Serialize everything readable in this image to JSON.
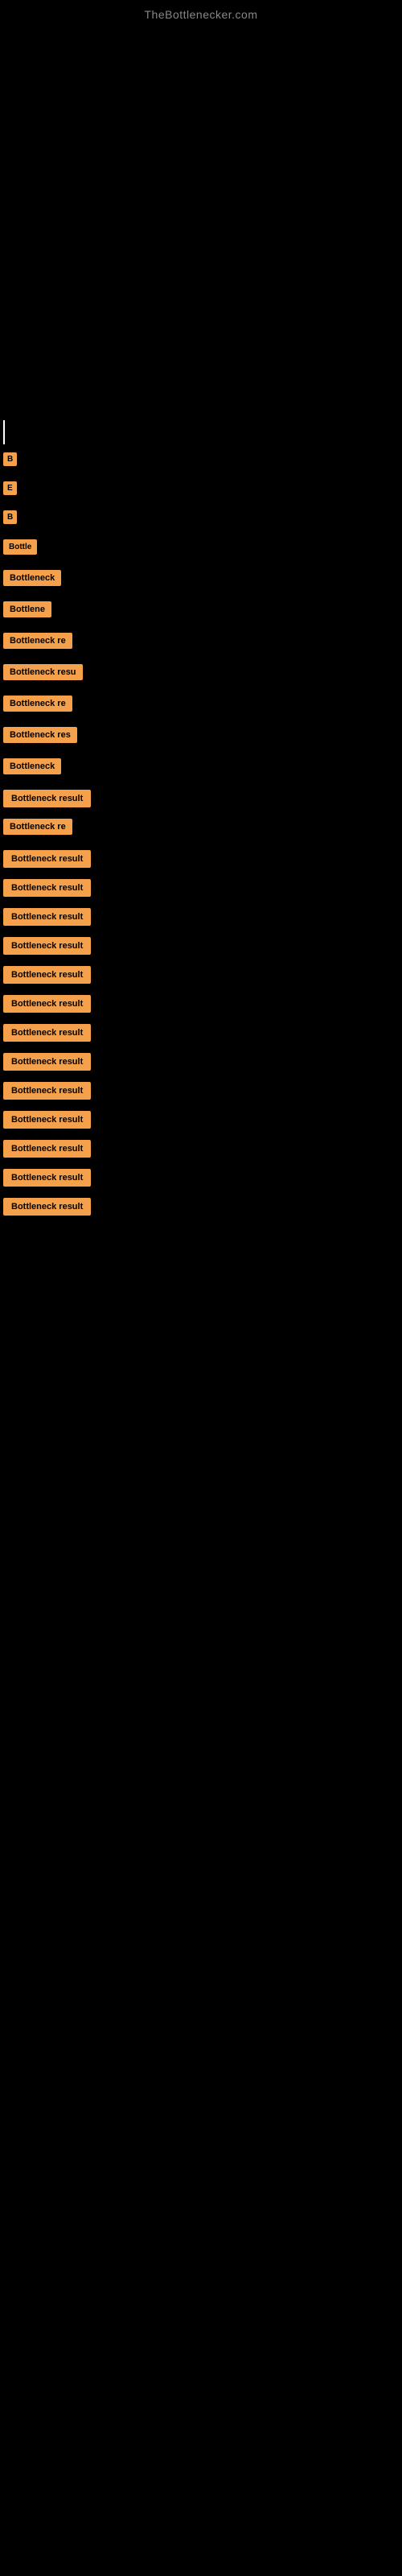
{
  "site": {
    "title": "TheBottlenecker.com"
  },
  "results": [
    {
      "id": 1,
      "label": "B",
      "size": "xs"
    },
    {
      "id": 2,
      "label": "E",
      "size": "xs"
    },
    {
      "id": 3,
      "label": "B",
      "size": "xs"
    },
    {
      "id": 4,
      "label": "Bottle",
      "size": "md"
    },
    {
      "id": 5,
      "label": "Bottleneck",
      "size": "lg"
    },
    {
      "id": 6,
      "label": "Bottlene",
      "size": "lg"
    },
    {
      "id": 7,
      "label": "Bottleneck re",
      "size": "xl"
    },
    {
      "id": 8,
      "label": "Bottleneck resu",
      "size": "xl"
    },
    {
      "id": 9,
      "label": "Bottleneck re",
      "size": "xl"
    },
    {
      "id": 10,
      "label": "Bottleneck res",
      "size": "xl"
    },
    {
      "id": 11,
      "label": "Bottleneck",
      "size": "lg"
    },
    {
      "id": 12,
      "label": "Bottleneck result",
      "size": "full"
    },
    {
      "id": 13,
      "label": "Bottleneck re",
      "size": "xl"
    },
    {
      "id": 14,
      "label": "Bottleneck result",
      "size": "full"
    },
    {
      "id": 15,
      "label": "Bottleneck result",
      "size": "full"
    },
    {
      "id": 16,
      "label": "Bottleneck result",
      "size": "full"
    },
    {
      "id": 17,
      "label": "Bottleneck result",
      "size": "full"
    },
    {
      "id": 18,
      "label": "Bottleneck result",
      "size": "full"
    },
    {
      "id": 19,
      "label": "Bottleneck result",
      "size": "full"
    },
    {
      "id": 20,
      "label": "Bottleneck result",
      "size": "full"
    },
    {
      "id": 21,
      "label": "Bottleneck result",
      "size": "full"
    },
    {
      "id": 22,
      "label": "Bottleneck result",
      "size": "full"
    },
    {
      "id": 23,
      "label": "Bottleneck result",
      "size": "full"
    },
    {
      "id": 24,
      "label": "Bottleneck result",
      "size": "full"
    },
    {
      "id": 25,
      "label": "Bottleneck result",
      "size": "full"
    },
    {
      "id": 26,
      "label": "Bottleneck result",
      "size": "full"
    }
  ]
}
